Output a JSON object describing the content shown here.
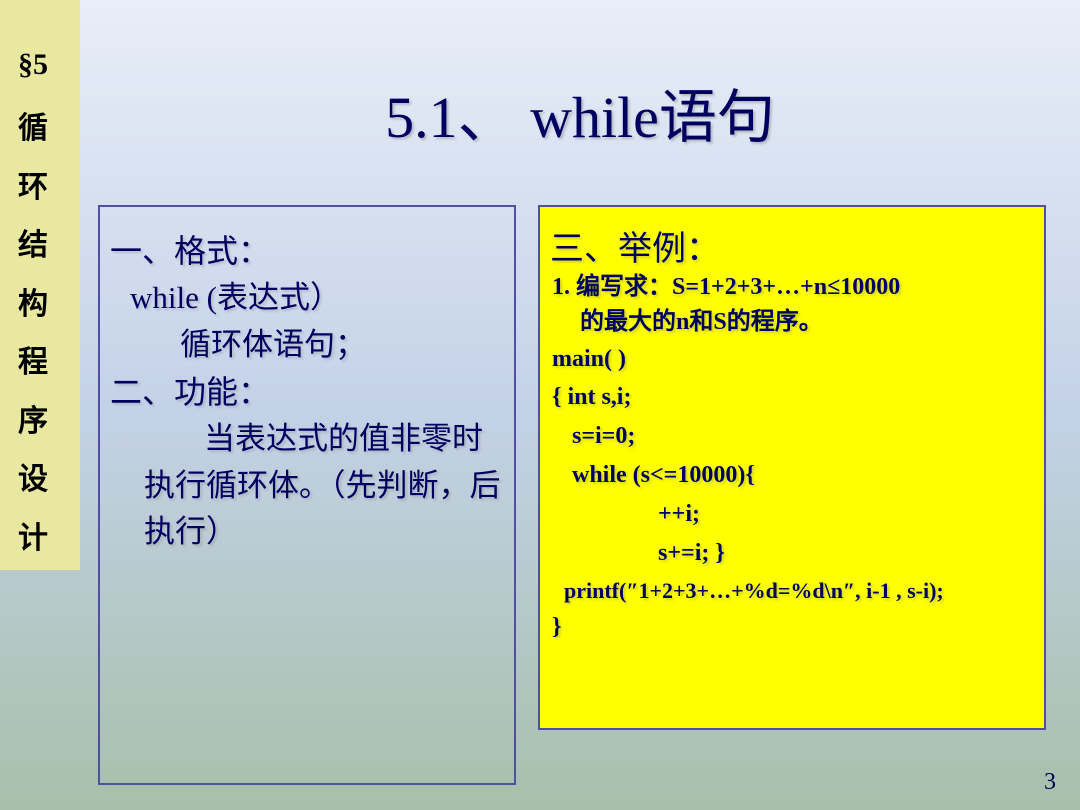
{
  "sidebar": {
    "section": "§5",
    "vertical": "循\n环\n结\n构\n程\n序\n设\n计"
  },
  "title": "5.1、 while语句",
  "left": {
    "h1": "一、格式：",
    "l1": "while (表达式）",
    "l2": "循环体语句；",
    "h2": "二、功能：",
    "body": "当表达式的值非零时执行循环体。（先判断，后执行）"
  },
  "right": {
    "h3": "三、举例：",
    "prob1": "1. 编写求：S=1+2+3+…+n≤10000",
    "prob2": "的最大的n和S的程序。",
    "c1": "main( )",
    "c2": "{  int s,i;",
    "c3": "s=i=0;",
    "c4": "while (s<=10000){",
    "c5": "++i;",
    "c6": "s+=i; }",
    "c7": "printf(″1+2+3+…+%d=%d\\n″, i-1 , s-i);",
    "c8": "}"
  },
  "page": "3"
}
